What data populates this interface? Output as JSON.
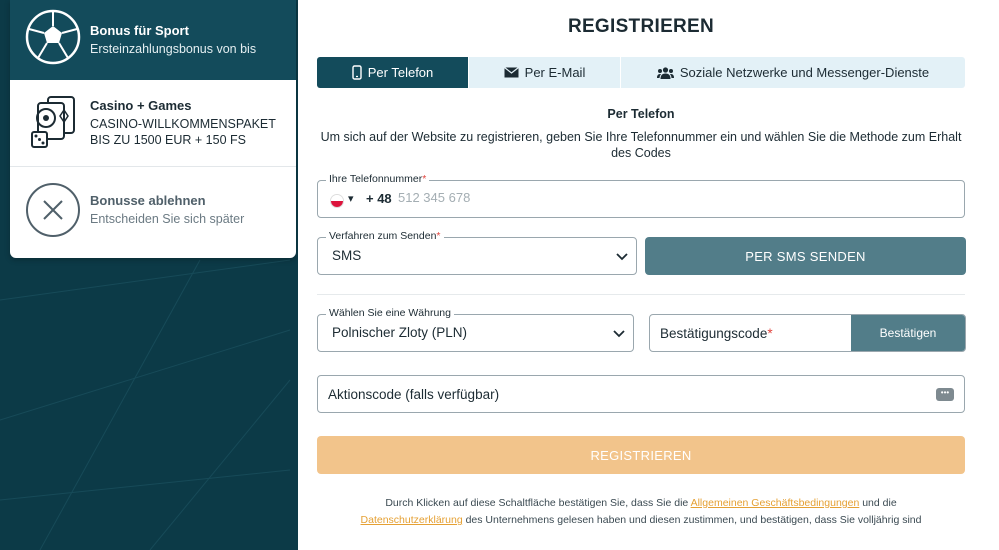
{
  "bonuses": [
    {
      "title": "Bonus für Sport",
      "subtitle": "Ersteinzahlungsbonus von bis"
    },
    {
      "title": "Casino + Games",
      "subtitle": "CASINO-WILLKOMMENSPAKET BIS ZU 1500 EUR + 150 FS"
    },
    {
      "title": "Bonusse ablehnen",
      "subtitle": "Entscheiden Sie sich später"
    }
  ],
  "form": {
    "title": "REGISTRIEREN",
    "tabs": [
      "Per Telefon",
      "Per E-Mail",
      "Soziale Netzwerke und Messenger-Dienste"
    ],
    "subheading": "Per Telefon",
    "description": "Um sich auf der Website zu registrieren, geben Sie Ihre Telefonnummer ein und wählen Sie die Methode zum Erhalt des Codes",
    "phone": {
      "label": "Ihre Telefonnummer",
      "required_mark": "*",
      "prefix": "+ 48",
      "placeholder": "512 345 678"
    },
    "method": {
      "label": "Verfahren zum Senden",
      "required_mark": "*",
      "value": "SMS"
    },
    "send_button": "PER SMS SENDEN",
    "currency": {
      "label": "Wählen Sie eine Währung",
      "value": "Polnischer Zloty (PLN)"
    },
    "confirmation": {
      "placeholder": "Bestätigungscode",
      "required_mark": "*",
      "button": "Bestätigen"
    },
    "promo": {
      "placeholder": "Aktionscode (falls verfügbar)"
    },
    "register_button": "REGISTRIEREN",
    "terms": {
      "part1": "Durch Klicken auf diese Schaltfläche bestätigen Sie, dass Sie die ",
      "link1": "Allgemeinen Geschäftsbedingungen",
      "part2": " und die ",
      "link2": "Datenschutzerklärung",
      "part3": " des Unternehmens gelesen haben und diesen zustimmen, und bestätigen, dass Sie volljährig sind"
    }
  },
  "icons": [
    "soccer-ball-icon",
    "casino-cards-dice-icon",
    "decline-x-icon",
    "phone-icon",
    "mail-icon",
    "users-icon",
    "chevron-down-icon",
    "message-icon"
  ],
  "colors": {
    "dark_teal": "#134b5b",
    "button_teal": "#527d89",
    "register_orange": "#f2c48b",
    "link_orange": "#e5a033",
    "tab_bg": "#e3f1f7"
  }
}
